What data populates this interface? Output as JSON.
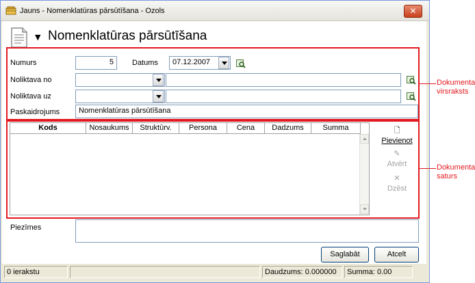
{
  "window": {
    "title": "Jauns - Nomenklatūras pārsūtīšana - Ozols",
    "close_glyph": "✕"
  },
  "header": {
    "dropdown_glyph": "▼",
    "title": "Nomenklatūras pārsūtīšana"
  },
  "form": {
    "numurs_label": "Numurs",
    "numurs_value": "5",
    "datums_label": "Datums",
    "datums_value": "07.12.2007",
    "noliktava_no_label": "Noliktava no",
    "noliktava_no_code": "",
    "noliktava_no_name": "",
    "noliktava_uz_label": "Noliktava uz",
    "noliktava_uz_code": "",
    "noliktava_uz_name": "",
    "paskaidrojums_label": "Paskaidrojums",
    "paskaidrojums_value": "Nomenklatūras pārsūtīšana"
  },
  "grid": {
    "columns": [
      "Kods",
      "Nosaukums",
      "Struktūrv.",
      "Persona",
      "Cena",
      "Dadzums",
      "Summa"
    ],
    "rows": []
  },
  "side_buttons": {
    "add": {
      "label": "Pievienot",
      "glyph": "🗋"
    },
    "open": {
      "label": "Atvērt",
      "glyph": "✎"
    },
    "delete": {
      "label": "Dzēst",
      "glyph": "✕"
    }
  },
  "notes": {
    "label": "Piezīmes",
    "value": ""
  },
  "buttons": {
    "save": "Saglabāt",
    "cancel": "Atcelt"
  },
  "status": {
    "records": "0 ierakstu",
    "quantity": "Daudzums: 0.000000",
    "sum": "Summa: 0.00"
  },
  "annotations": {
    "header_line1": "Dokumenta",
    "header_line2": "virsraksts",
    "content_line1": "Dokumenta",
    "content_line2": "saturs"
  },
  "colors": {
    "annotation": "#e2181f",
    "window_bg": "#ece9d8",
    "input_border": "#7f9db9"
  },
  "icons": {
    "app": "ozols-app-icon",
    "document": "document-icon",
    "lookup": "lookup-magnifier-icon"
  }
}
